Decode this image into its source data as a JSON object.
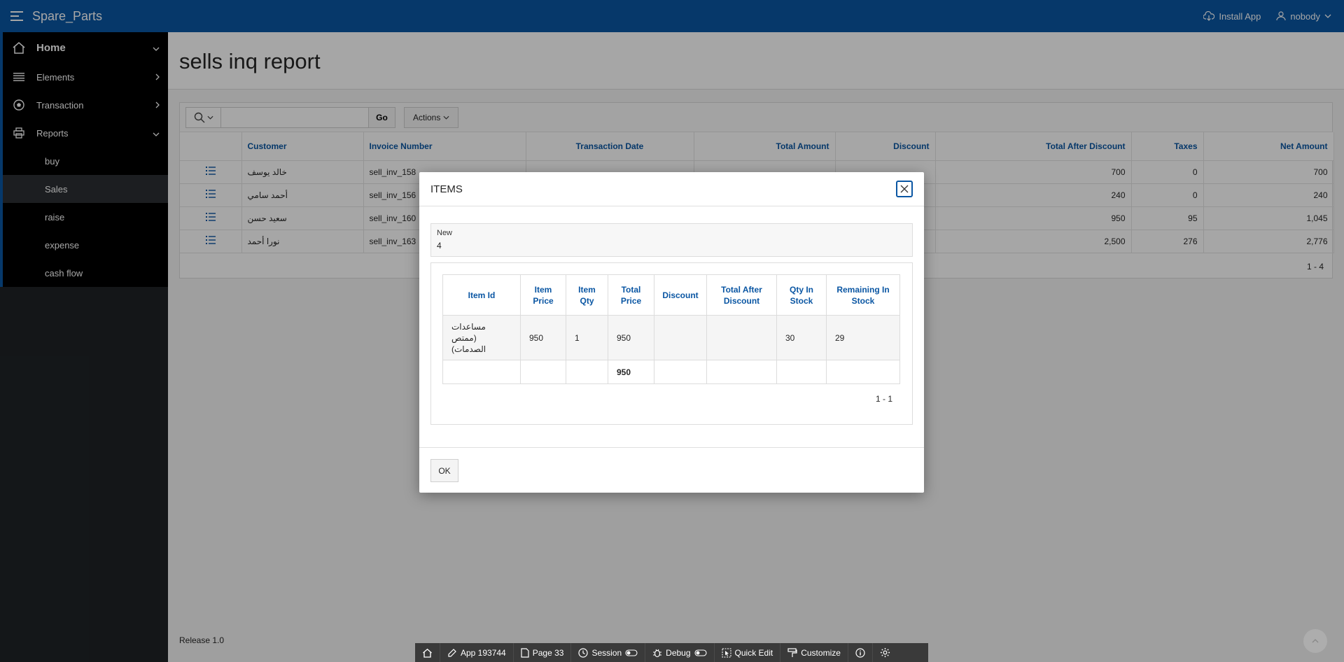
{
  "header": {
    "app_name": "Spare_Parts",
    "install_label": "Install App",
    "user_label": "nobody"
  },
  "sidebar": {
    "items": [
      {
        "label": "Home"
      },
      {
        "label": "Elements"
      },
      {
        "label": "Transaction"
      },
      {
        "label": "Reports"
      }
    ],
    "sub_items": [
      {
        "label": "buy"
      },
      {
        "label": "Sales"
      },
      {
        "label": "raise"
      },
      {
        "label": "expense"
      },
      {
        "label": "cash flow"
      }
    ]
  },
  "page": {
    "title": "sells inq report"
  },
  "toolbar": {
    "go_label": "Go",
    "actions_label": "Actions"
  },
  "report": {
    "columns": [
      "Customer",
      "Invoice Number",
      "Transaction Date",
      "Total Amount",
      "Discount",
      "Total After Discount",
      "Taxes",
      "Net Amount"
    ],
    "rows": [
      {
        "customer": "خالد يوسف",
        "invoice": "sell_inv_158",
        "date": "",
        "total": "",
        "discount": "",
        "after_discount": "700",
        "taxes": "0",
        "net": "700"
      },
      {
        "customer": "أحمد سامي",
        "invoice": "sell_inv_156",
        "date": "",
        "total": "",
        "discount": "",
        "after_discount": "240",
        "taxes": "0",
        "net": "240"
      },
      {
        "customer": "سعيد حسن",
        "invoice": "sell_inv_160",
        "date": "",
        "total": "",
        "discount": "",
        "after_discount": "950",
        "taxes": "95",
        "net": "1,045"
      },
      {
        "customer": "نورا أحمد",
        "invoice": "sell_inv_163",
        "date": "",
        "total": "",
        "discount": "",
        "after_discount": "2,500",
        "taxes": "276",
        "net": "2,776"
      }
    ],
    "pagination": "1 - 4"
  },
  "dialog": {
    "title": "ITEMS",
    "field_label": "New",
    "field_value": "4",
    "columns": [
      "Item Id",
      "Item Price",
      "Item Qty",
      "Total Price",
      "Discount",
      "Total After Discount",
      "Qty In Stock",
      "Remaining In Stock"
    ],
    "row": {
      "item_id": "مساعدات (ممتص الصدمات)",
      "price": "950",
      "qty": "1",
      "total": "950",
      "discount": "",
      "after_discount": "",
      "qty_stock": "30",
      "remaining": "29"
    },
    "total_row": {
      "total": "950"
    },
    "pagination": "1 - 1",
    "ok_label": "OK"
  },
  "footer": {
    "release": "Release 1.0"
  },
  "devbar": {
    "app_label": "App 193744",
    "page_label": "Page 33",
    "session_label": "Session",
    "debug_label": "Debug",
    "quick_edit_label": "Quick Edit",
    "customize_label": "Customize"
  },
  "colors": {
    "header_bg": "#0a56a3",
    "link": "#0a56a3",
    "sidebar_bg": "#1f2326"
  }
}
